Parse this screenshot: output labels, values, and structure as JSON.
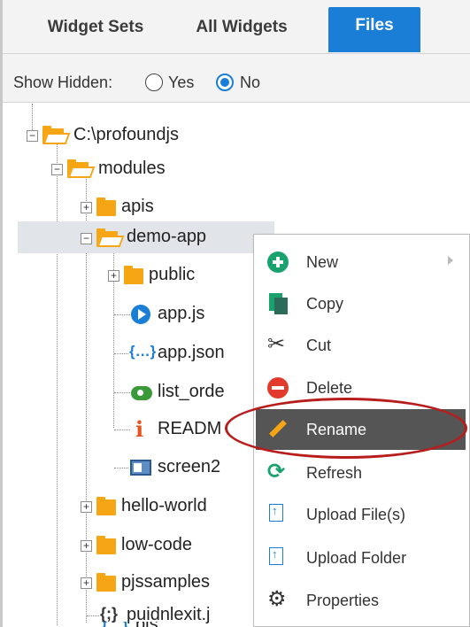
{
  "tabs": [
    {
      "label": "Widget Sets"
    },
    {
      "label": "All Widgets"
    },
    {
      "label": "Files",
      "active": true
    }
  ],
  "show_hidden": {
    "label": "Show Hidden:",
    "options": [
      {
        "label": "Yes"
      },
      {
        "label": "No"
      }
    ],
    "selected": "No"
  },
  "tree": {
    "root": "C:\\profoundjs",
    "modules": "modules",
    "apis": "apis",
    "demo_app": "demo-app",
    "public": "public",
    "app_js": "app.js",
    "app_json": "app.json",
    "list_orders": "list_orde",
    "readme": "READM",
    "screen2": "screen2",
    "hello_world": "hello-world",
    "low_code": "low-code",
    "pjssamples": "pjssamples",
    "puidnlexit": "puidnlexit.j",
    "pjs_partial": "pjs"
  },
  "context_menu": {
    "items": [
      {
        "label": "New",
        "icon": "plus-circle-icon"
      },
      {
        "label": "Copy",
        "icon": "copy-icon"
      },
      {
        "label": "Cut",
        "icon": "scissors-icon"
      },
      {
        "label": "Delete",
        "icon": "minus-circle-icon"
      },
      {
        "label": "Rename",
        "icon": "pencil-icon",
        "hover": true
      },
      {
        "label": "Refresh",
        "icon": "refresh-icon"
      },
      {
        "label": "Upload File(s)",
        "icon": "upload-file-icon"
      },
      {
        "label": "Upload Folder",
        "icon": "upload-folder-icon"
      },
      {
        "label": "Properties",
        "icon": "gear-icon"
      }
    ]
  },
  "colors": {
    "accent": "#1a7ed6",
    "folder": "#f6a614",
    "highlight": "#b81d1d",
    "menu_hover": "#555555"
  }
}
